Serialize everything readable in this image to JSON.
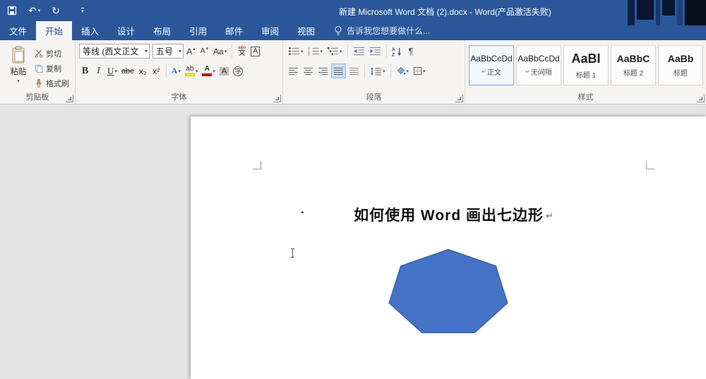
{
  "window": {
    "title": "新建 Microsoft Word 文档 (2).docx - Word(产品激活失败)"
  },
  "icons": {
    "dropdown": "▾",
    "up": "▴",
    "undo": "↶",
    "redo": "↻",
    "paragraph": "¶"
  },
  "tabs": {
    "file": "文件",
    "items": [
      "开始",
      "插入",
      "设计",
      "布局",
      "引用",
      "邮件",
      "审阅",
      "视图"
    ],
    "active": "开始",
    "tell_me": "告诉我您想要做什么..."
  },
  "ribbon": {
    "clipboard": {
      "label": "剪贴板",
      "paste": "粘贴",
      "cut": "剪切",
      "copy": "复制",
      "format_painter": "格式刷"
    },
    "font": {
      "label": "字体",
      "name_value": "等线 (西文正文",
      "size_value": "五号",
      "grow": "A",
      "shrink": "A",
      "change_case": "Aa",
      "phonetic_top": "wén",
      "phonetic_bottom": "文",
      "char_border": "A",
      "bold": "B",
      "italic": "I",
      "underline": "U",
      "strike": "abc",
      "subscript": "x₂",
      "superscript": "x²",
      "effects": "A",
      "highlight": "ab",
      "color": "A",
      "char_shading": "A",
      "enclose": "字"
    },
    "paragraph": {
      "label": "段落"
    },
    "styles": {
      "label": "样式",
      "items": [
        {
          "preview": "AaBbCcDd",
          "mark": "↵",
          "name": "正文"
        },
        {
          "preview": "AaBbCcDd",
          "mark": "↵",
          "name": "无间隔"
        },
        {
          "preview": "AaBI",
          "mark": "",
          "name": "标题 1"
        },
        {
          "preview": "AaBbC",
          "mark": "",
          "name": "标题 2"
        },
        {
          "preview": "AaBb",
          "mark": "",
          "name": "标题"
        }
      ]
    }
  },
  "document": {
    "heading": "如何使用 Word 画出七边形",
    "list_bullet": "·",
    "paragraph_mark": "↵",
    "shape": {
      "type": "heptagon",
      "fill": "#4472C4",
      "stroke": "#3A62A8"
    }
  },
  "colors": {
    "titlebar": "#2B579A",
    "ribbon_bg": "#F5F4F2",
    "page_bg": "#FFFFFF",
    "shape_fill": "#4472C4"
  }
}
